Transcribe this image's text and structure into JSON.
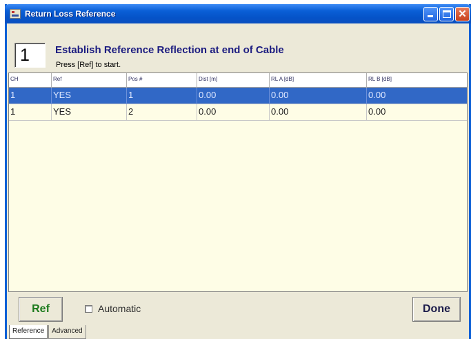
{
  "window": {
    "title": "Return Loss Reference"
  },
  "step": {
    "number": "1",
    "heading": "Establish Reference Reflection at end of Cable",
    "instruction": "Press [Ref] to start."
  },
  "table": {
    "headers": [
      "CH",
      "Ref",
      "Pos #",
      "Dist [m]",
      "RL A [dB]",
      "RL B [dB]"
    ],
    "rows": [
      {
        "ch": "1",
        "ref": "YES",
        "pos": "1",
        "dist": "0.00",
        "rl_a": "0.00",
        "rl_b": "0.00",
        "selected": true
      },
      {
        "ch": "1",
        "ref": "YES",
        "pos": "2",
        "dist": "0.00",
        "rl_a": "0.00",
        "rl_b": "0.00",
        "selected": false
      }
    ]
  },
  "controls": {
    "ref_label": "Ref",
    "automatic_label": "Automatic",
    "automatic_checked": false,
    "done_label": "Done"
  },
  "tabs": [
    {
      "label": "Reference",
      "active": true
    },
    {
      "label": "Advanced",
      "active": false
    }
  ],
  "colors": {
    "selection": "#3168c6",
    "ref_text": "#1b7a1b",
    "heading_text": "#1c1c80"
  }
}
